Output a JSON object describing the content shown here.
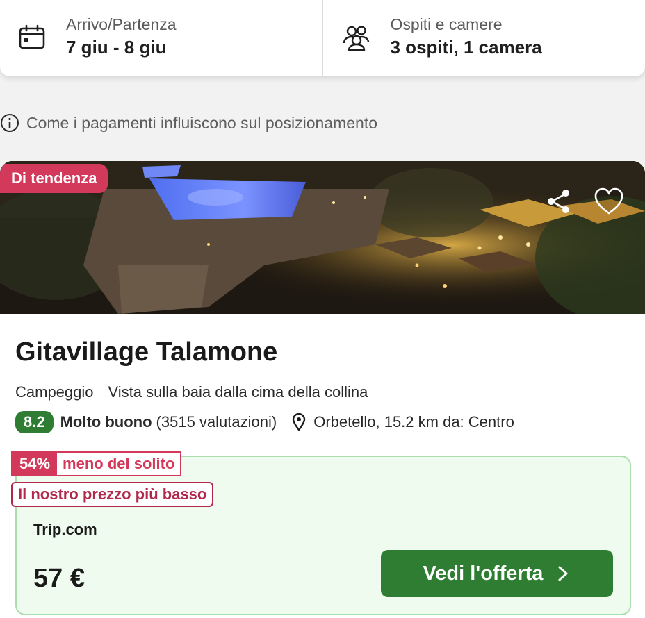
{
  "search": {
    "dates_label": "Arrivo/Partenza",
    "dates_value": "7 giu - 8 giu",
    "guests_label": "Ospiti e camere",
    "guests_value": "3 ospiti, 1 camera",
    "dates_icon": "calendar-icon",
    "guests_icon": "people-icon"
  },
  "info": {
    "text": "Come i pagamenti influiscono sul posizionamento",
    "icon": "info-icon"
  },
  "hotel": {
    "badge": "Di tendenza",
    "name": "Gitavillage Talamone",
    "type": "Campeggio",
    "feature": "Vista sulla baia dalla cima della collina",
    "score": "8.2",
    "rating_word": "Molto buono",
    "reviews": "(3515 valutazioni)",
    "location": "Orbetello, 15.2 km da: Centro",
    "share_icon": "share-icon",
    "favorite_icon": "heart-icon",
    "score_color": "#2e7d32"
  },
  "deal": {
    "discount_pct": "54%",
    "discount_text": "meno del solito",
    "lowest_price": "Il nostro prezzo più basso",
    "provider": "Trip.com",
    "price": "57 €",
    "cta": "Vedi l'offerta",
    "cta_color": "#2e7d32",
    "badge_color": "#d3395a"
  }
}
